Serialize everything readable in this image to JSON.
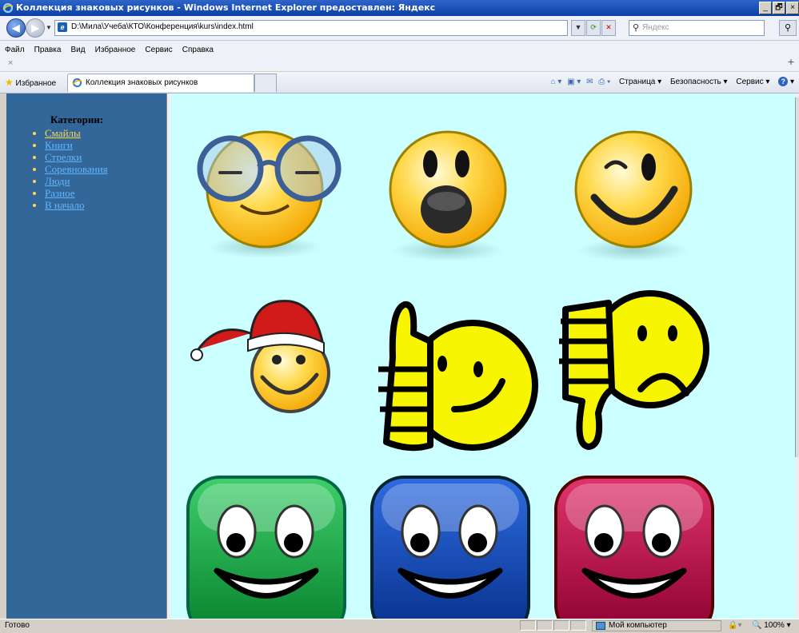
{
  "window": {
    "title": "Коллекция знаковых рисунков - Windows Internet Explorer предоставлен: Яндекс",
    "buttons": [
      "_",
      "🗗",
      "×"
    ]
  },
  "address_bar": {
    "url": "D:\\Мила\\Учеба\\КТО\\Конференция\\kurs\\index.html",
    "search_placeholder": "Яндекс"
  },
  "menu": {
    "items": [
      "Файл",
      "Правка",
      "Вид",
      "Избранное",
      "Сервис",
      "Справка"
    ]
  },
  "favorites_bar": {
    "favorites_label": "Избранное",
    "tab_label": "Коллекция знаковых рисунков",
    "commands": {
      "page": "Страница",
      "safety": "Безопасность",
      "tools": "Сервис"
    }
  },
  "sidebar": {
    "heading": "Категории:",
    "items": [
      {
        "label": "Смайлы",
        "active": true
      },
      {
        "label": "Книги",
        "active": false
      },
      {
        "label": "Стрелки",
        "active": false
      },
      {
        "label": "Соревнования",
        "active": false
      },
      {
        "label": "Люди",
        "active": false
      },
      {
        "label": "Разное",
        "active": false
      },
      {
        "label": "В начало",
        "active": false
      }
    ]
  },
  "gallery": {
    "images": [
      "smiley-glasses-icon",
      "smiley-surprised-icon",
      "smiley-wink-icon",
      "smiley-santa-hat-icon",
      "smiley-thumbs-up-icon",
      "smiley-thumbs-down-icon",
      "green-square-smiley-icon",
      "blue-square-smiley-icon",
      "red-square-smiley-icon"
    ],
    "colors": {
      "background": "#ccffff",
      "green": "#0a9b3a",
      "blue": "#0b3fa6",
      "red": "#b0003a",
      "yellow": "#f7e81a"
    }
  },
  "statusbar": {
    "status": "Готово",
    "zone": "Мой компьютер",
    "zoom": "100%"
  }
}
